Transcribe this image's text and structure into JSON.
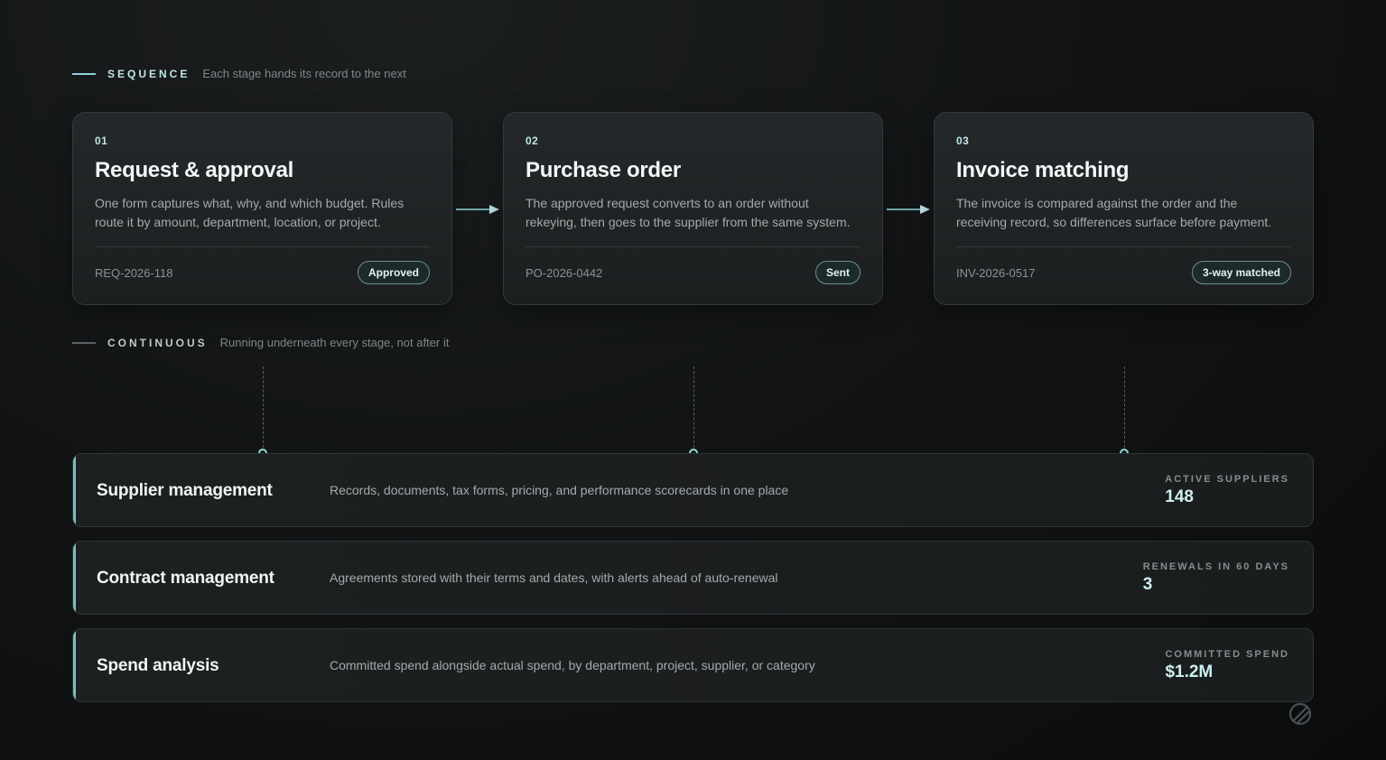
{
  "sequence": {
    "kicker": "SEQUENCE",
    "subtitle": "Each stage hands its record to the next",
    "stages": [
      {
        "num": "01",
        "title": "Request & approval",
        "desc": "One form captures what, why, and which budget. Rules route it by amount, department, location, or project.",
        "ref": "REQ-2026-118",
        "status": "Approved"
      },
      {
        "num": "02",
        "title": "Purchase order",
        "desc": "The approved request converts to an order without rekeying, then goes to the supplier from the same system.",
        "ref": "PO-2026-0442",
        "status": "Sent"
      },
      {
        "num": "03",
        "title": "Invoice matching",
        "desc": "The invoice is compared against the order and the receiving record, so differences surface before payment.",
        "ref": "INV-2026-0517",
        "status": "3-way matched"
      }
    ]
  },
  "continuous": {
    "kicker": "CONTINUOUS",
    "subtitle": "Running underneath every stage, not after it",
    "capabilities": [
      {
        "title": "Supplier management",
        "desc": "Records, documents, tax forms, pricing, and performance scorecards in one place",
        "metric_label": "ACTIVE SUPPLIERS",
        "metric_value": "148"
      },
      {
        "title": "Contract management",
        "desc": "Agreements stored with their terms and dates, with alerts ahead of auto-renewal",
        "metric_label": "RENEWALS IN 60 DAYS",
        "metric_value": "3"
      },
      {
        "title": "Spend analysis",
        "desc": "Committed spend alongside actual spend, by department, project, supplier, or category",
        "metric_label": "COMMITTED SPEND",
        "metric_value": "$1.2M"
      }
    ]
  },
  "icons": {
    "arrow": "arrow-right-icon",
    "node": "connector-node-icon",
    "logo": "brand-logo-icon"
  },
  "colors": {
    "accent": "#8fd3db",
    "background": "#121415",
    "card": "#202325"
  }
}
